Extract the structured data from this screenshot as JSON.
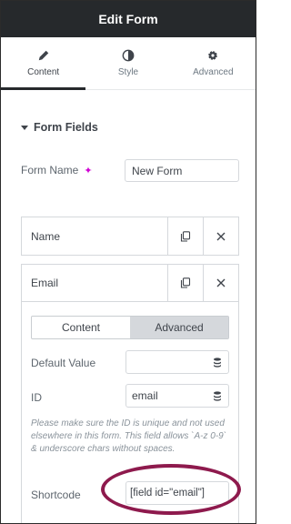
{
  "header": {
    "title": "Edit Form"
  },
  "tabs": [
    {
      "label": "Content",
      "icon": "pencil-icon",
      "active": true
    },
    {
      "label": "Style",
      "icon": "half-circle-icon",
      "active": false
    },
    {
      "label": "Advanced",
      "icon": "gear-icon",
      "active": false
    }
  ],
  "section": {
    "title": "Form Fields"
  },
  "form_name": {
    "label": "Form Name",
    "value": "New Form"
  },
  "fields": [
    {
      "title": "Name"
    },
    {
      "title": "Email"
    }
  ],
  "email_panel": {
    "subtabs": [
      "Content",
      "Advanced"
    ],
    "active_subtab": "Advanced",
    "default_value": {
      "label": "Default Value",
      "value": ""
    },
    "id": {
      "label": "ID",
      "value": "email"
    },
    "help": "Please make sure the ID is unique and not used elsewhere in this form. This field allows `A-z 0-9` & underscore chars without spaces.",
    "shortcode": {
      "label": "Shortcode",
      "value": "[field id=\"email\"]"
    }
  },
  "colors": {
    "header_bg": "#26292c",
    "highlight_ring": "#8e1a4d",
    "ai_sparkle": "#d004d4"
  }
}
